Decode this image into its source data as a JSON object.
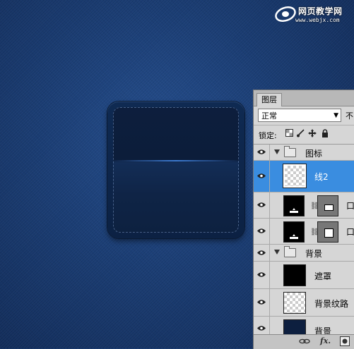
{
  "watermark": {
    "title": "网页教学网",
    "url": "www.webjx.com"
  },
  "panel": {
    "tab_label": "图层",
    "blend_mode": "正常",
    "opacity_label": "不",
    "lock_label": "锁定:",
    "layers": [
      {
        "name": "图标",
        "kind": "group",
        "visible": true
      },
      {
        "name": "线2",
        "kind": "layer",
        "visible": true,
        "selected": true,
        "thumb": "transparent"
      },
      {
        "name": "口",
        "kind": "shape-mask",
        "visible": true,
        "thumb": "black"
      },
      {
        "name": "口",
        "kind": "shape-mask",
        "visible": true,
        "thumb": "black"
      },
      {
        "name": "背景",
        "kind": "group",
        "visible": true
      },
      {
        "name": "遮罩",
        "kind": "layer",
        "visible": true,
        "thumb": "black"
      },
      {
        "name": "背景纹路",
        "kind": "layer",
        "visible": true,
        "thumb": "transparent"
      },
      {
        "name": "背景",
        "kind": "layer",
        "visible": true,
        "thumb": "navy"
      }
    ],
    "footer": {
      "link_icon": "link-icon",
      "fx_label": "fx.",
      "mask_icon": "add-mask-icon"
    }
  },
  "colors": {
    "background": "#1a3c72",
    "selection": "#3a8de0",
    "panel": "#d6d6d6"
  }
}
